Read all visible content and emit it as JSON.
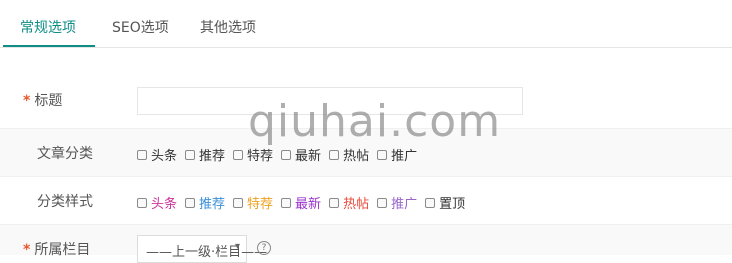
{
  "tabs": [
    {
      "label": "常规选项",
      "active": true
    },
    {
      "label": "SEO选项",
      "active": false
    },
    {
      "label": "其他选项",
      "active": false
    }
  ],
  "form": {
    "title": {
      "required_mark": "*",
      "label": "标题",
      "value": ""
    },
    "category": {
      "label": "文章分类",
      "options": [
        "头条",
        "推荐",
        "特荐",
        "最新",
        "热帖",
        "推广"
      ]
    },
    "style": {
      "label": "分类样式",
      "options": [
        {
          "label": "头条",
          "color": "#cc3399"
        },
        {
          "label": "推荐",
          "color": "#3a8fd9"
        },
        {
          "label": "特荐",
          "color": "#f0a020"
        },
        {
          "label": "最新",
          "color": "#9a33cc"
        },
        {
          "label": "热帖",
          "color": "#e84a3a"
        },
        {
          "label": "推广",
          "color": "#9966cc"
        },
        {
          "label": "置顶",
          "color": "#333333"
        }
      ]
    },
    "column": {
      "required_mark": "*",
      "label": "所属栏目",
      "selected": "——上一级·栏目——",
      "chevron": "▾",
      "help": "?"
    }
  },
  "watermark": "qiuhai.com",
  "accent": "#0f8e86"
}
